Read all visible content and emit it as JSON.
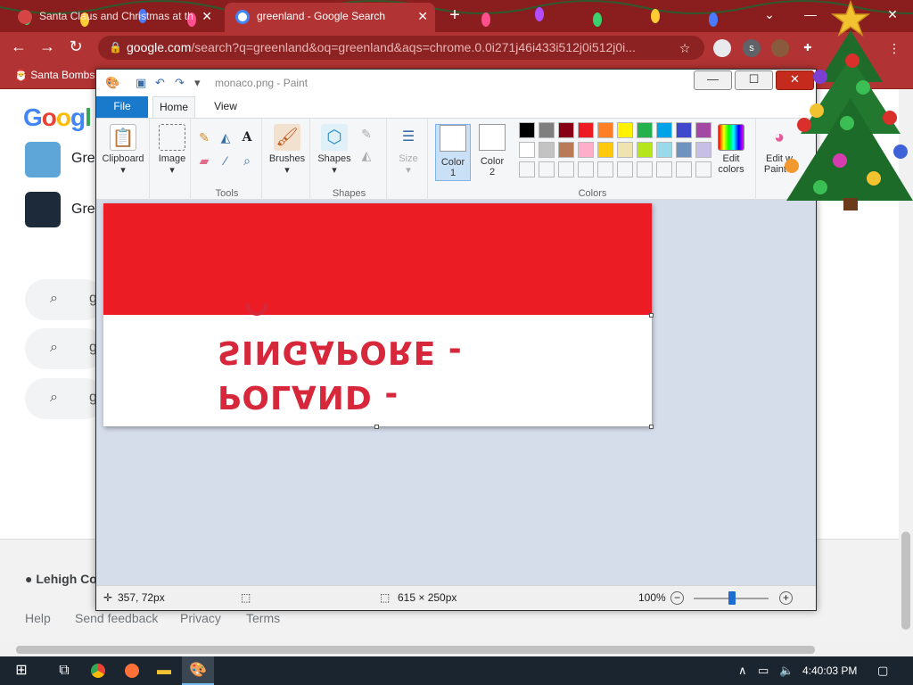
{
  "browser": {
    "tabs": [
      {
        "label": "Santa Claus and Christmas at th",
        "active": false
      },
      {
        "label": "greenland - Google Search",
        "active": true
      }
    ],
    "url_main": "google.com",
    "url_rest": "/search?q=greenland&oq=greenland&aqs=chrome.0.0i271j46i433i512j0i512j0i...",
    "bookmark": "Santa Bombs",
    "profile_initial": "s",
    "theme_color": "#b23333"
  },
  "google": {
    "logo": "Google",
    "results": [
      {
        "text": "Gre"
      },
      {
        "text": "Gre"
      }
    ],
    "related": [
      {
        "text": "g"
      },
      {
        "text": "g"
      },
      {
        "text": "g"
      }
    ],
    "footer_location": "Lehigh Co",
    "footer_links": [
      "Help",
      "Send feedback",
      "Privacy",
      "Terms"
    ]
  },
  "paint": {
    "title": "monaco.png - Paint",
    "tabs": {
      "file": "File",
      "home": "Home",
      "view": "View"
    },
    "groups": {
      "clipboard": "Clipboard",
      "image": "Image",
      "tools": "Tools",
      "brushes": "Brushes",
      "shapes_btn": "Shapes",
      "shapes": "Shapes",
      "size": "Size",
      "color1": "Color\n1",
      "color2": "Color\n2",
      "edit_colors": "Edit\ncolors",
      "colors": "Colors",
      "edit_paint3d": "Edit w\nPaint 3"
    },
    "palette_row1": [
      "#000000",
      "#7f7f7f",
      "#880015",
      "#ed1c24",
      "#ff7f27",
      "#fff200",
      "#22b14c",
      "#00a2e8",
      "#3f48cc",
      "#a349a4"
    ],
    "palette_row2": [
      "#ffffff",
      "#c3c3c3",
      "#b97a57",
      "#ffaec9",
      "#ffc90e",
      "#efe4b0",
      "#b5e61d",
      "#99d9ea",
      "#7092be",
      "#c8bfe7"
    ],
    "canvas": {
      "text_line1": "SINGAPORE -",
      "text_line2": "POLAND -",
      "flag_red": "#ec1c24"
    },
    "status": {
      "cursor_pos": "357, 72px",
      "image_size": "615 × 250px",
      "zoom": "100%"
    }
  },
  "taskbar": {
    "time": "4:40:03 PM"
  }
}
